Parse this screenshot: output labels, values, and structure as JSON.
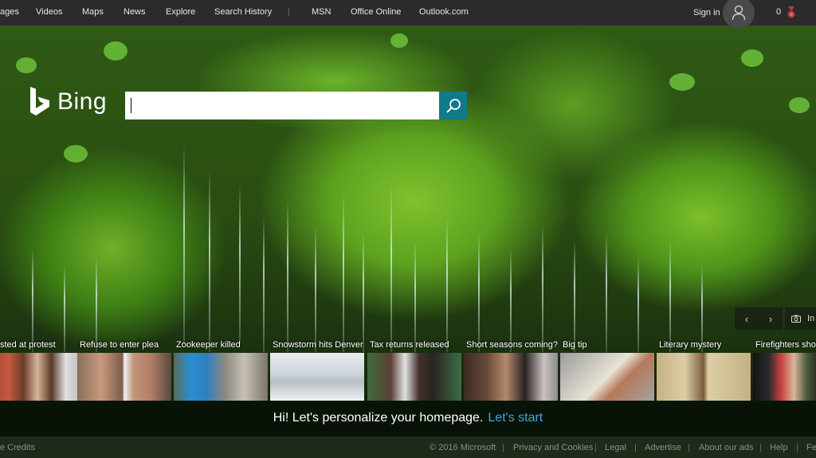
{
  "topbar": {
    "nav": [
      "ages",
      "Videos",
      "Maps",
      "News",
      "Explore",
      "Search History",
      "|",
      "MSN",
      "Office Online",
      "Outlook.com"
    ],
    "signin_label": "Sign in",
    "rewards_count": "0"
  },
  "logo": {
    "text": "Bing"
  },
  "search": {
    "value": "",
    "placeholder": ""
  },
  "carousel": {
    "info_label": "In"
  },
  "news": [
    {
      "title": "sted at protest",
      "thumb_icon": "protest-photo"
    },
    {
      "title": "Refuse to enter plea",
      "thumb_icon": "two-men-photo"
    },
    {
      "title": "Zookeeper killed",
      "thumb_icon": "zookeeper-photo"
    },
    {
      "title": "Snowstorm hits Denver",
      "thumb_icon": "snow-street-photo"
    },
    {
      "title": "Tax returns released",
      "thumb_icon": "obamas-photo"
    },
    {
      "title": "Short seasons coming?",
      "thumb_icon": "actor-photo"
    },
    {
      "title": "Big tip",
      "thumb_icon": "receipt-photo"
    },
    {
      "title": "Literary mystery",
      "thumb_icon": "notebook-photo"
    },
    {
      "title": "Firefighters shot",
      "thumb_icon": "firefighter-photo"
    }
  ],
  "personalize": {
    "text": "Hi! Let's personalize your homepage.",
    "cta": "Let's start"
  },
  "footer": {
    "left": "e Credits",
    "links": [
      "© 2016 Microsoft",
      "|",
      "Privacy and Cookies",
      "|",
      "Legal",
      "|",
      "Advertise",
      "|",
      "About our ads",
      "|",
      "Help",
      "|",
      "Fe"
    ]
  },
  "colors": {
    "topbar": "#2b2b2b",
    "accent": "#0f7a8a",
    "link": "#3fa8e0"
  }
}
